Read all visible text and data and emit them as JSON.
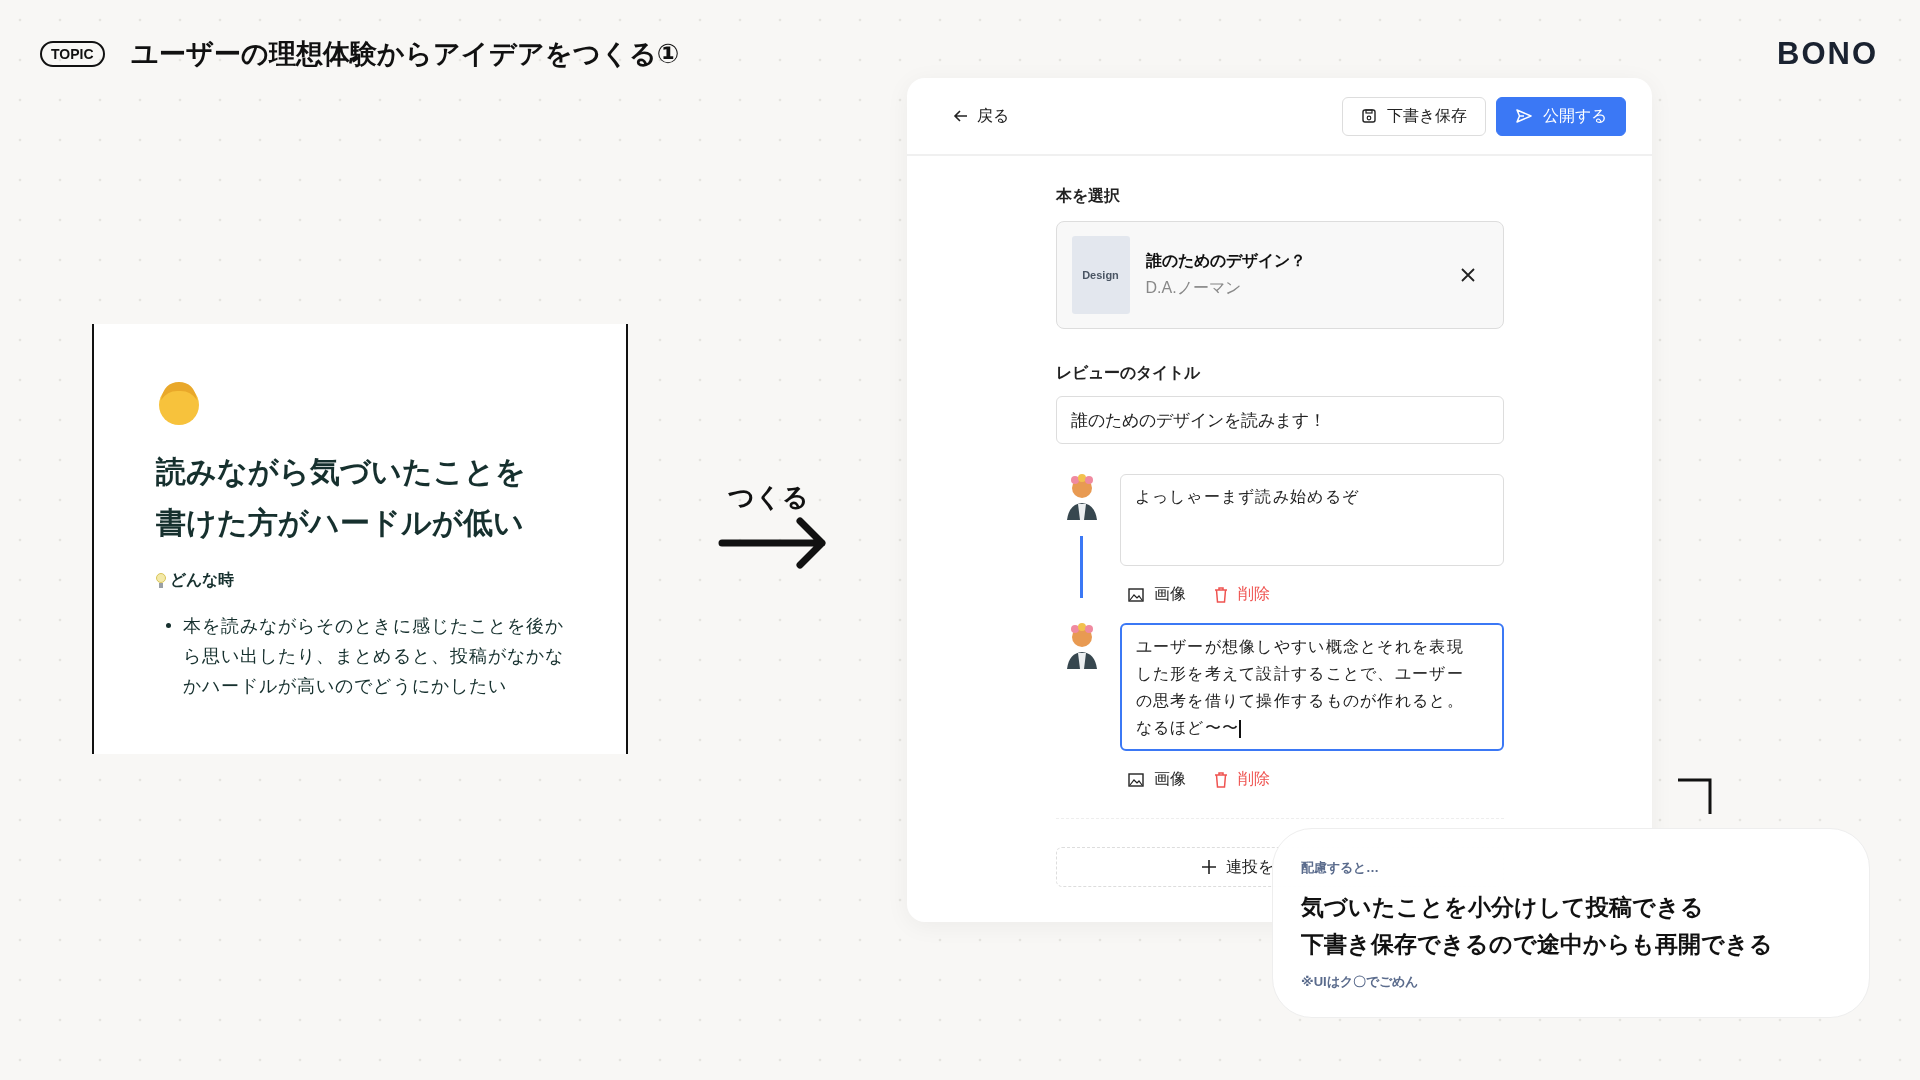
{
  "header": {
    "tag": "TOPIC",
    "title": "ユーザーの理想体験からアイデアをつくる①",
    "logo": "BONO"
  },
  "idea_card": {
    "heading_lines": [
      "読みながら気づいたことを",
      "書けた方がハードルが低い"
    ],
    "section_label": "どんな時",
    "bullets": [
      "本を読みながらそのときに感じたことを後から思い出したり、まとめると、投稿がなかなかハードルが高いのでどうにかしたい"
    ]
  },
  "arrow_label": "つくる",
  "editor": {
    "back": "戻る",
    "buttons": [
      {
        "label": "下書き保存",
        "kind": "secondary"
      },
      {
        "label": "公開する",
        "kind": "primary"
      }
    ],
    "book_label": "本を選択",
    "book": {
      "cover": "Design",
      "title": "誰のためのデザイン？",
      "author": "D.A.ノーマン"
    },
    "title_label": "レビューのタイトル",
    "title_value": "誰のためのデザインを読みます！",
    "posts": [
      {
        "text": "よっしゃーまず読み始めるぞ",
        "focused": false,
        "image": "画像",
        "delete": "削除"
      },
      {
        "text": "ユーザーが想像しやすい概念とそれを表現した形を考えて設計することで、ユーザーの思考を借りて操作するものが作れると。なるほど〜〜",
        "focused": true,
        "image": "画像",
        "delete": "削除"
      }
    ],
    "add_thread": "連投を"
  },
  "note": {
    "kicker": "配慮すると…",
    "lines": [
      "気づいたことを小分けして投稿できる",
      "下書き保存できるので途中からも再開できる"
    ],
    "footnote": "※UIはク〇でごめん"
  }
}
